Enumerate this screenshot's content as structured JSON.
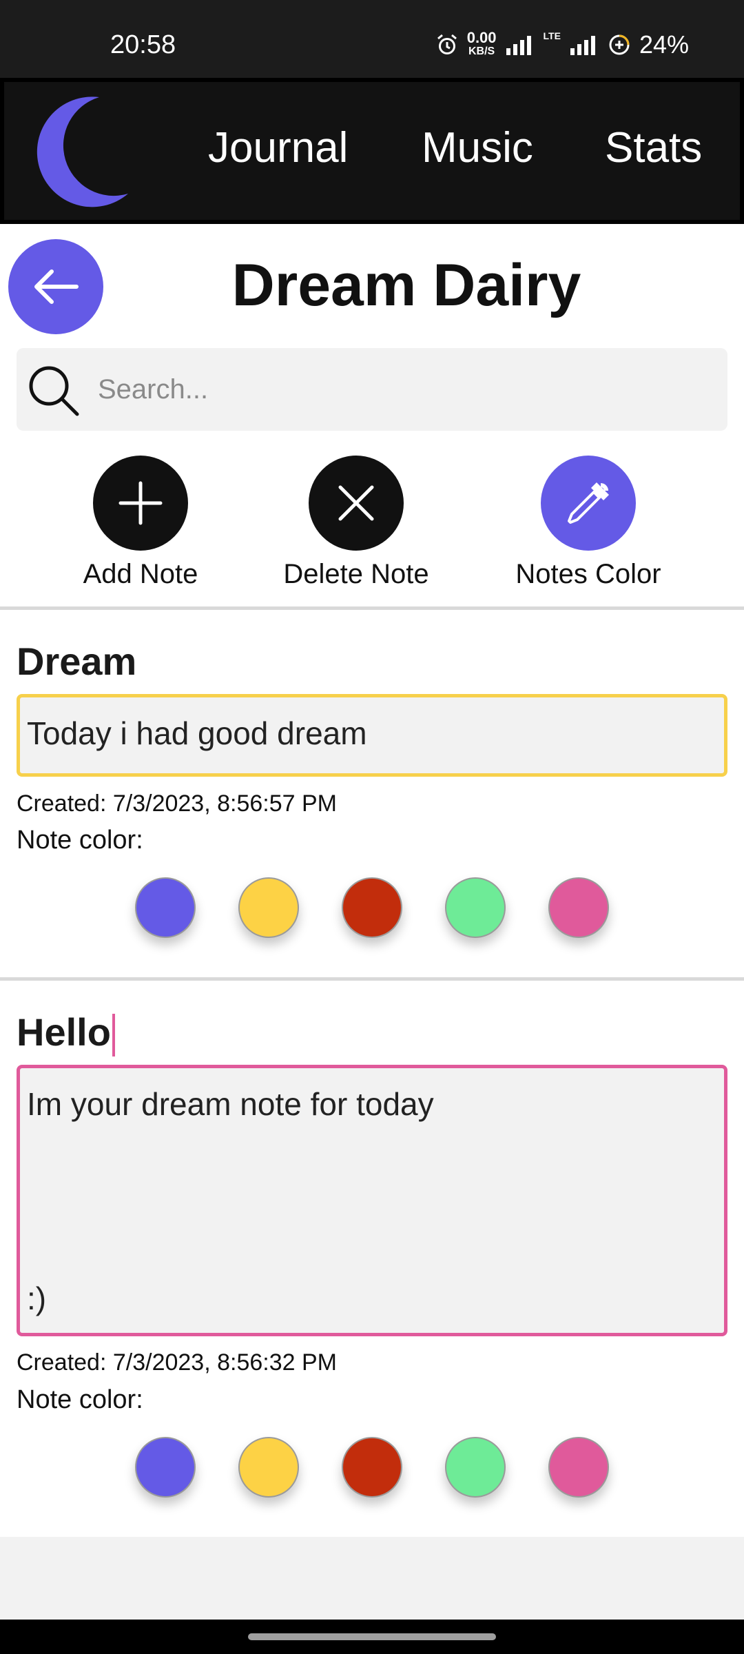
{
  "status_bar": {
    "time": "20:58",
    "net_speed_value": "0.00",
    "net_speed_unit": "KB/S",
    "network_label": "LTE",
    "battery": "24%",
    "icons": [
      "alarm-icon",
      "signal-icon",
      "lte-signal-icon",
      "battery-saver-icon"
    ]
  },
  "nav": {
    "logo_icon": "moon-icon",
    "items": [
      {
        "label": "Journal"
      },
      {
        "label": "Music"
      },
      {
        "label": "Stats"
      }
    ]
  },
  "header": {
    "back_icon": "arrow-left-icon",
    "title": "Dream Dairy"
  },
  "search": {
    "placeholder": "Search...",
    "value": ""
  },
  "actions": [
    {
      "label": "Add Note",
      "icon": "plus-icon",
      "color": "#111111"
    },
    {
      "label": "Delete Note",
      "icon": "close-icon",
      "color": "#111111"
    },
    {
      "label": "Notes Color",
      "icon": "eyedropper-icon",
      "color": "#645ae6"
    }
  ],
  "notes": [
    {
      "title": "Dream",
      "body_lines": [
        "Today i had good dream"
      ],
      "created": "Created: 7/3/2023, 8:56:57 PM",
      "color_label": "Note color:",
      "border_color": "#f7d04b"
    },
    {
      "title": "Hello",
      "body_lines": [
        "Im your dream note for today",
        ":)"
      ],
      "created": "Created: 7/3/2023, 8:56:32 PM",
      "color_label": "Note color:",
      "border_color": "#e05a9b"
    }
  ],
  "palette": [
    "#645ae6",
    "#fdd245",
    "#c22d0c",
    "#6eeb97",
    "#e05a9b"
  ],
  "colors": {
    "accent": "#645ae6",
    "status_bar_bg": "#1c1c1c",
    "nav_bg": "#121212"
  }
}
